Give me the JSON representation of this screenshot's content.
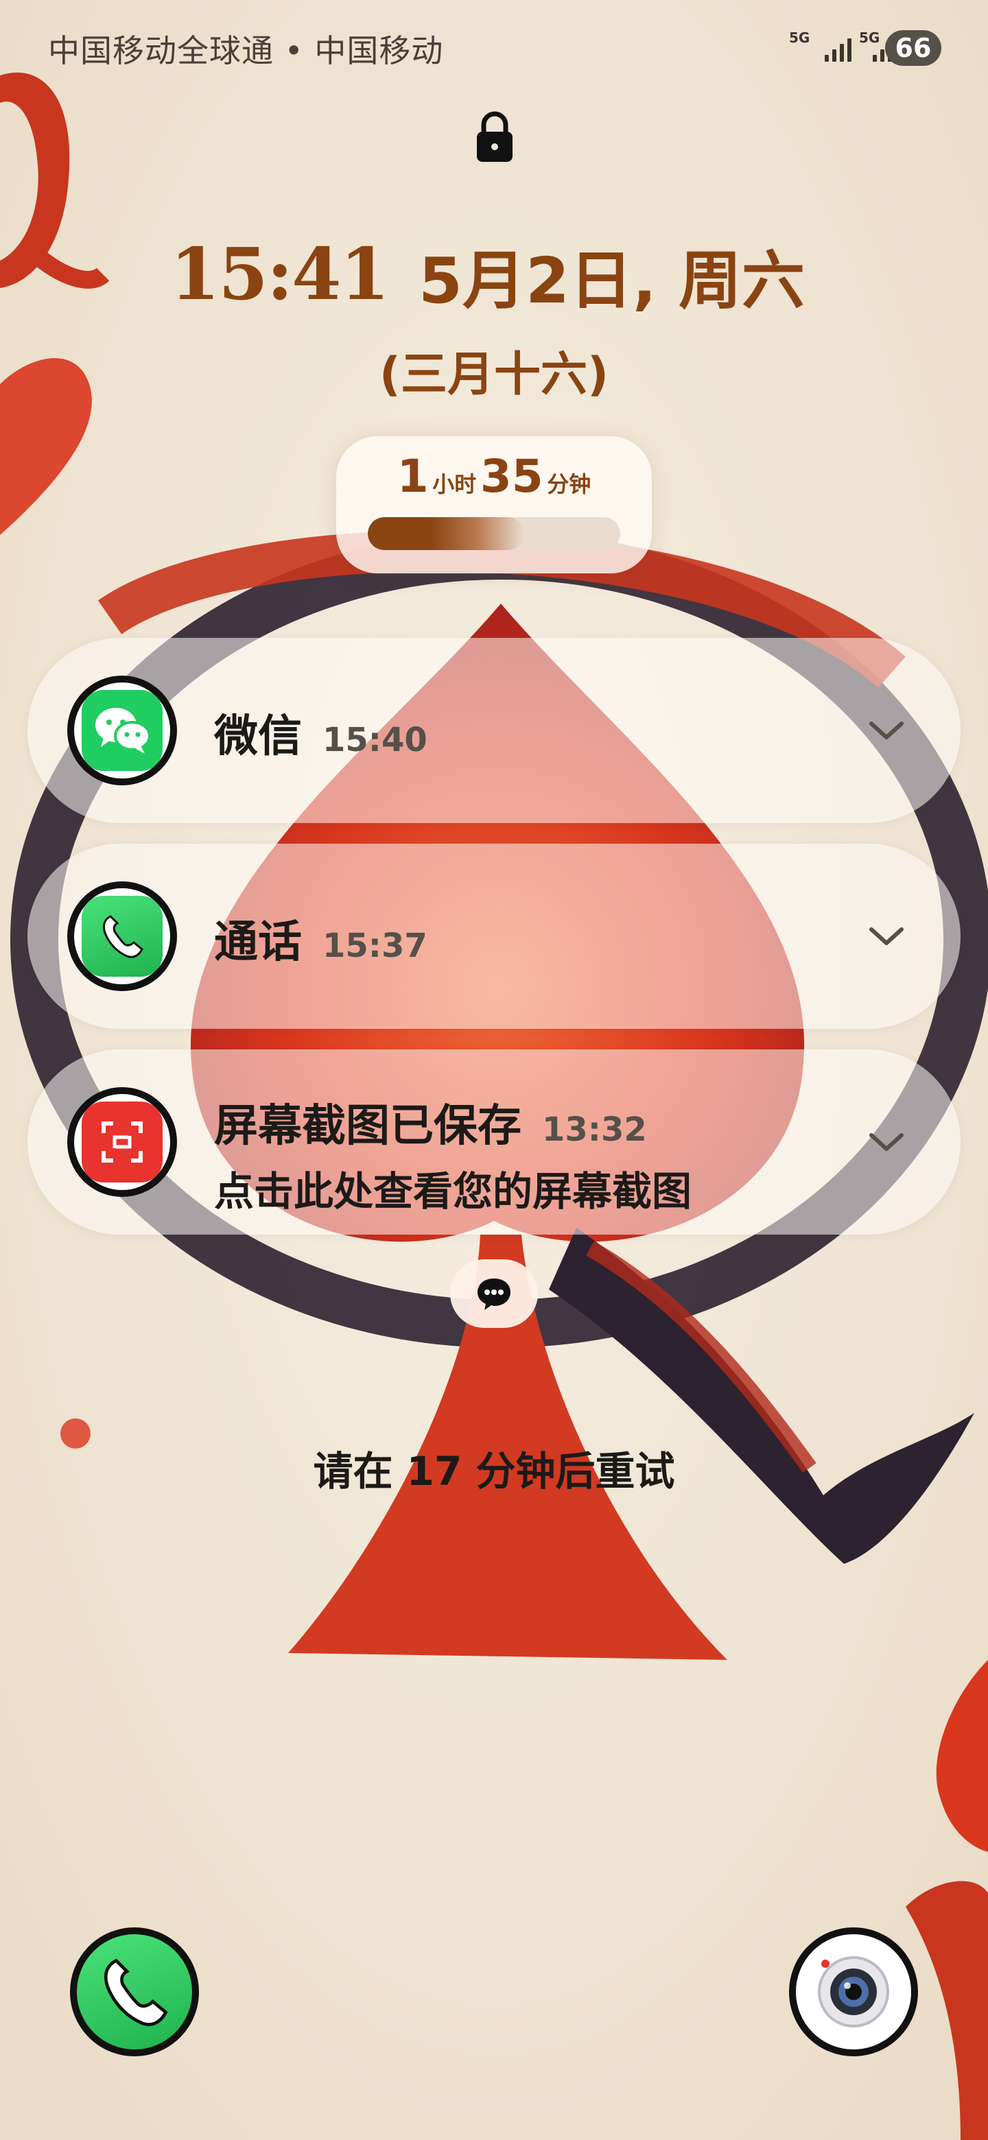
{
  "status_bar": {
    "carrier": "中国移动全球通 • 中国移动",
    "network_1": "5G",
    "network_2": "5G",
    "battery": "66"
  },
  "lock": {
    "time": "15:41",
    "date": "5月2日, 周六",
    "lunar": "(三月十六)"
  },
  "screen_time": {
    "hours": "1",
    "hours_unit": "小时",
    "minutes": "35",
    "minutes_unit": "分钟",
    "progress_fraction": 0.62
  },
  "notifications": [
    {
      "app": "微信",
      "time": "15:40",
      "icon": "wechat-icon",
      "color": "#1fcd60"
    },
    {
      "app": "通话",
      "time": "15:37",
      "icon": "phone-icon",
      "color": "#22c05a"
    },
    {
      "app": "屏幕截图已保存",
      "time": "13:32",
      "body": "点击此处查看您的屏幕截图",
      "icon": "screenshot-icon",
      "color": "#e8332e"
    }
  ],
  "retry_message": "请在 17 分钟后重试",
  "shortcuts": {
    "left": "phone-icon",
    "right": "camera-icon"
  },
  "colors": {
    "accent_brown": "#8a4412",
    "background": "#f1e8da",
    "wallpaper_red": "#d83a1f",
    "wallpaper_dark": "#2d2230"
  }
}
